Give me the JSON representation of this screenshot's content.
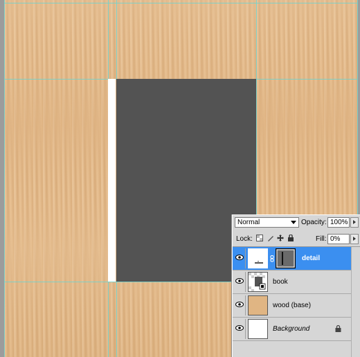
{
  "layers_panel": {
    "blend_mode": "Normal",
    "opacity_label": "Opacity:",
    "opacity_value": "100%",
    "lock_label": "Lock:",
    "fill_label": "Fill:",
    "fill_value": "0%",
    "layers": [
      {
        "name": "detail",
        "selected": true,
        "visible": true
      },
      {
        "name": "book",
        "selected": false,
        "visible": true
      },
      {
        "name": "wood (base)",
        "selected": false,
        "visible": true
      },
      {
        "name": "Background",
        "selected": false,
        "visible": true,
        "locked": true
      }
    ]
  },
  "colors": {
    "selection": "#3b8ff0",
    "guide": "#6fd4d0",
    "book_cover": "#535353",
    "wood": "#e3b683"
  }
}
